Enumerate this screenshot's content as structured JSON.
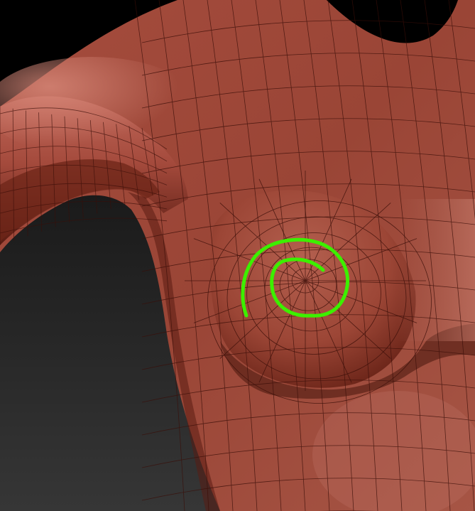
{
  "scene": {
    "background_color": "#000000",
    "backdrop_gradient": [
      "#1a1a1a",
      "#3a3a3a"
    ],
    "mesh_color": "#a04a3c",
    "mesh_highlight": "#d27a6a",
    "mesh_shadow": "#4a1810",
    "wire_color": "#3a0e08",
    "annotation_color": "#3cf000"
  },
  "annotation": {
    "type": "hand-drawn-spiral",
    "icon": "spiral-annotation"
  }
}
